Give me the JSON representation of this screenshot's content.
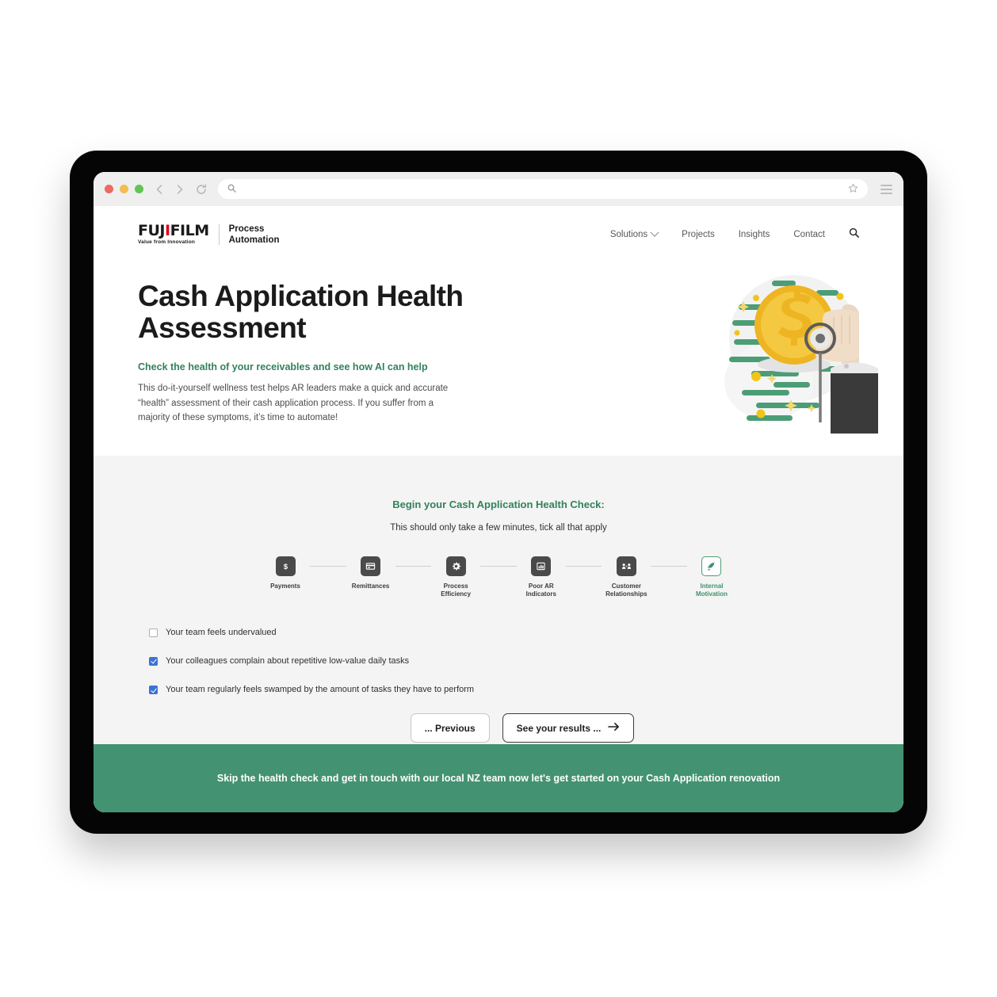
{
  "browser": {
    "traffic_lights": [
      "close",
      "minimize",
      "maximize"
    ],
    "back_icon": "chevron-left-icon",
    "forward_icon": "chevron-right-icon",
    "reload_icon": "reload-icon",
    "search_icon": "search-icon",
    "url_value": "",
    "url_placeholder": "",
    "bookmark_icon": "star-icon",
    "menu_icon": "hamburger-menu-icon"
  },
  "site": {
    "logo": {
      "brand": "FUJIFILM",
      "brand_prefix": "FUJ",
      "brand_dots": "I",
      "brand_suffix": "FILM",
      "tagline": "Value from Innovation",
      "unit_line1": "Process",
      "unit_line2": "Automation",
      "accent_color": "#e2001a"
    },
    "nav": [
      {
        "label": "Solutions",
        "has_dropdown": true
      },
      {
        "label": "Projects",
        "has_dropdown": false
      },
      {
        "label": "Insights",
        "has_dropdown": false
      },
      {
        "label": "Contact",
        "has_dropdown": false
      }
    ],
    "nav_search_icon": "search-icon"
  },
  "hero": {
    "title": "Cash Application Health Assessment",
    "subtitle": "Check the health of your receivables and see how AI can help",
    "body": "This do-it-yourself wellness test helps AR leaders make a quick and accurate “health” assessment of their cash application process. If you suffer from a majority of these symptoms, it’s time to automate!",
    "illustration_name": "coin-stethoscope-illustration",
    "green": "#33815c"
  },
  "form": {
    "heading": "Begin your Cash Application Health Check:",
    "hint": "This should only take a few minutes, tick all that apply",
    "steps": [
      {
        "label": "Payments",
        "icon": "dollar-icon",
        "active": false
      },
      {
        "label": "Remittances",
        "icon": "card-icon",
        "active": false
      },
      {
        "label": "Process Efficiency",
        "icon": "gear-icon",
        "active": false
      },
      {
        "label": "Poor AR Indicators",
        "icon": "bar-chart-icon",
        "active": false
      },
      {
        "label": "Customer Relationships",
        "icon": "people-icon",
        "active": false
      },
      {
        "label": "Internal Motivation",
        "icon": "rocket-icon",
        "active": true
      }
    ],
    "checkboxes": [
      {
        "label": "Your team feels undervalued",
        "checked": false
      },
      {
        "label": "Your colleagues complain about repetitive low-value daily tasks",
        "checked": true
      },
      {
        "label": "Your team regularly feels swamped by the amount of tasks they have to perform",
        "checked": true
      }
    ],
    "previous_label": "... Previous",
    "next_label": "See your results ...",
    "next_icon": "arrow-right-icon"
  },
  "banner": {
    "text": "Skip the health check and get in touch with our local NZ team now let's get started on your Cash Application renovation",
    "background": "#439372"
  }
}
